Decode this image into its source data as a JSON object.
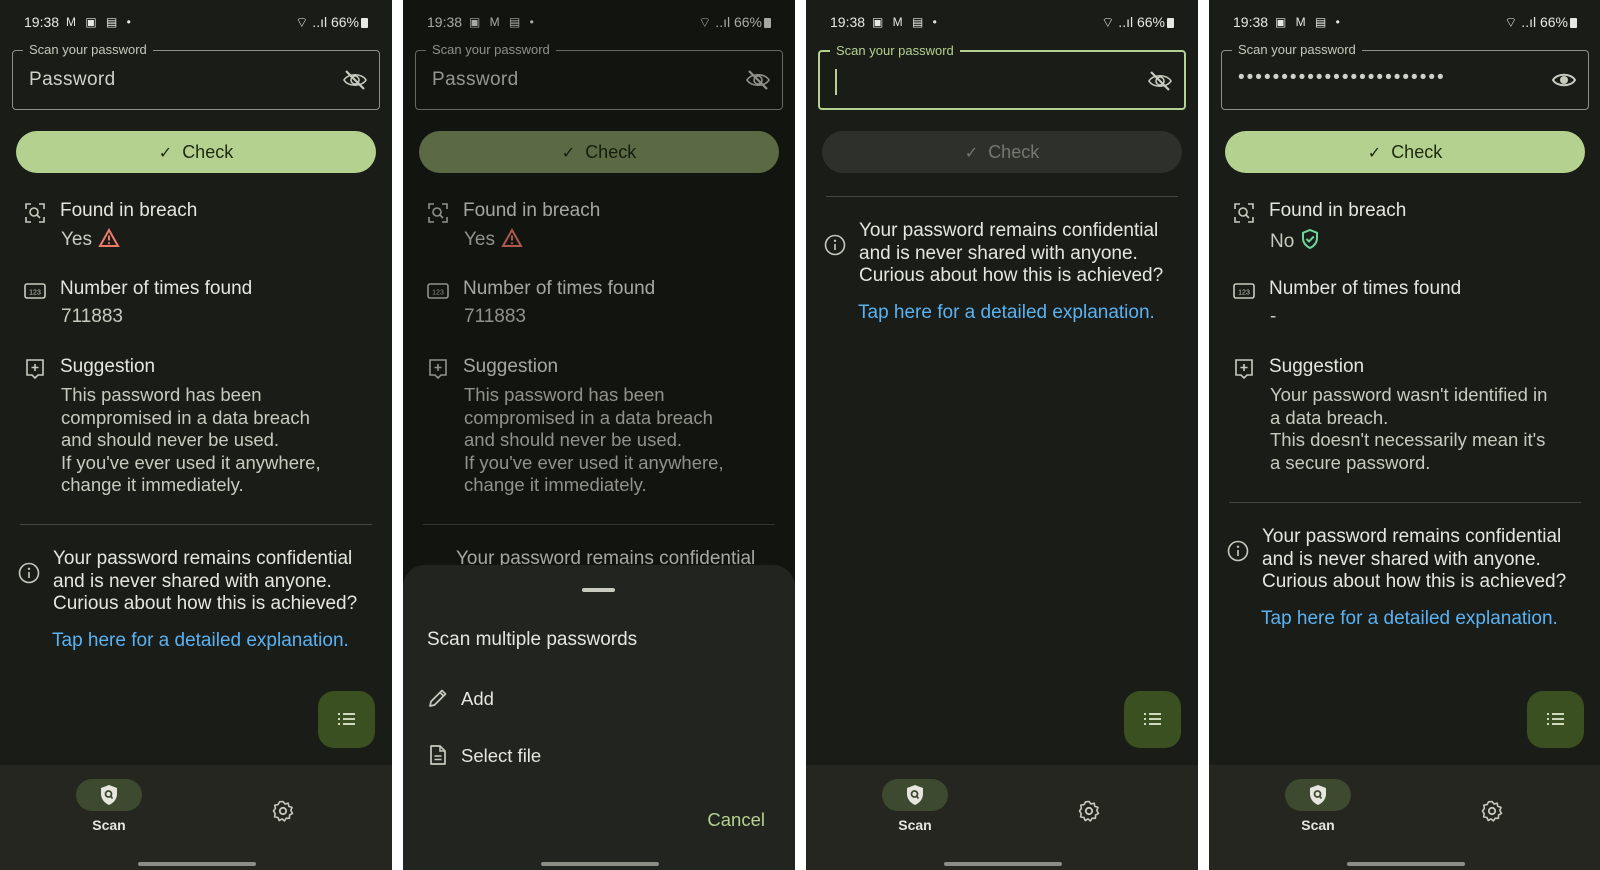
{
  "status": {
    "time": "19:38",
    "battery": "66%"
  },
  "field": {
    "label": "Scan your password",
    "placeholder": "Password",
    "masked_value": "••••••••••••••••••••••••"
  },
  "check_label": "Check",
  "breach": {
    "title": "Found in breach",
    "yes": "Yes",
    "no": "No"
  },
  "times": {
    "title": "Number of times found",
    "value": "711883",
    "none": "-"
  },
  "suggestion": {
    "title": "Suggestion",
    "compromised": "This password has been\ncompromised in a data breach\nand should never be used.\nIf you've ever used it anywhere,\nchange it immediately.",
    "safe": "Your password wasn't identified in\na data breach.\nThis doesn't necessarily mean it's\na secure password."
  },
  "info": {
    "text": "Your password remains confidential\nand is never shared with anyone.\nCurious about how this is achieved?",
    "link": "Tap here for a detailed explanation.",
    "peek": "Your password remains confidential"
  },
  "nav": {
    "scan": "Scan"
  },
  "sheet": {
    "title": "Scan multiple passwords",
    "add": "Add",
    "select_file": "Select file",
    "cancel": "Cancel"
  },
  "colors": {
    "accent": "#b5d190",
    "link": "#5ab2f2",
    "warning": "#f07a6a",
    "safe": "#6fd59a",
    "background": "#1a1c17"
  }
}
